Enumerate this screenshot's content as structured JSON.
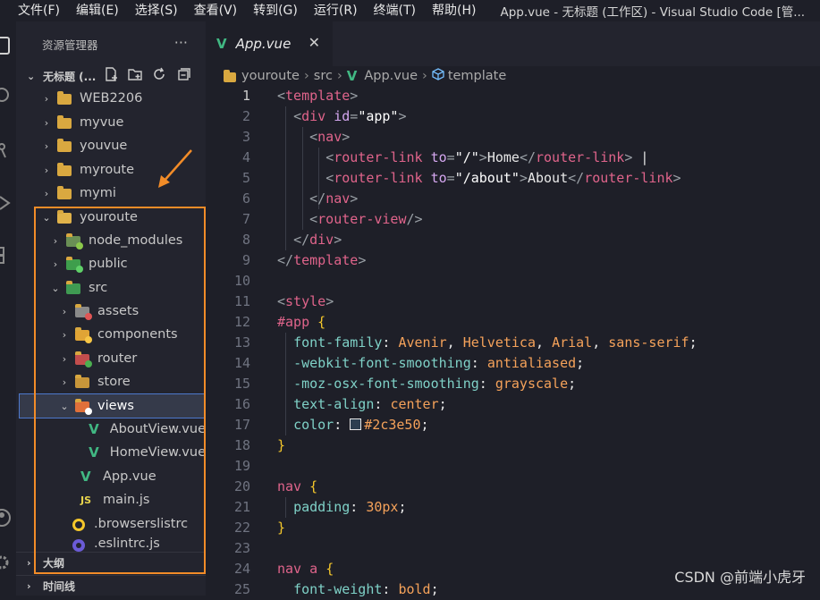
{
  "menubar": {
    "items": [
      "文件(F)",
      "编辑(E)",
      "选择(S)",
      "查看(V)",
      "转到(G)",
      "运行(R)",
      "终端(T)",
      "帮助(H)"
    ],
    "window_title": "App.vue - 无标题 (工作区) - Visual Studio Code [管..."
  },
  "sidebar": {
    "header": "资源管理器",
    "more": "···",
    "workspace": "无标题 (...",
    "tree": [
      {
        "label": "WEB2206",
        "chev": "›",
        "icon": "folder"
      },
      {
        "label": "myvue",
        "chev": "›",
        "icon": "folder"
      },
      {
        "label": "youvue",
        "chev": "›",
        "icon": "folder"
      },
      {
        "label": "myroute",
        "chev": "›",
        "icon": "folder"
      },
      {
        "label": "mymi",
        "chev": "›",
        "icon": "folder"
      },
      {
        "label": "youroute",
        "chev": "⌄",
        "icon": "folder-open"
      },
      {
        "label": "node_modules",
        "chev": "›",
        "icon": "folder-node"
      },
      {
        "label": "public",
        "chev": "›",
        "icon": "folder-public"
      },
      {
        "label": "src",
        "chev": "⌄",
        "icon": "folder-src"
      },
      {
        "label": "assets",
        "chev": "›",
        "icon": "folder-assets"
      },
      {
        "label": "components",
        "chev": "›",
        "icon": "folder-components"
      },
      {
        "label": "router",
        "chev": "›",
        "icon": "folder-router"
      },
      {
        "label": "store",
        "chev": "›",
        "icon": "folder-store"
      },
      {
        "label": "views",
        "chev": "⌄",
        "icon": "folder-views"
      },
      {
        "label": "AboutView.vue",
        "chev": "",
        "icon": "vue-file"
      },
      {
        "label": "HomeView.vue",
        "chev": "",
        "icon": "vue-file"
      },
      {
        "label": "App.vue",
        "chev": "",
        "icon": "vue-file"
      },
      {
        "label": "main.js",
        "chev": "",
        "icon": "js-file"
      },
      {
        "label": ".browserslistrc",
        "chev": "",
        "icon": "browserslist-file"
      },
      {
        "label": ".eslintrc.js",
        "chev": "",
        "icon": "eslint-file"
      }
    ],
    "panels": [
      "大纲",
      "时间线"
    ]
  },
  "editor": {
    "tab": {
      "label": "App.vue",
      "close": "✕"
    },
    "breadcrumbs": [
      "youroute",
      "src",
      "App.vue",
      "template"
    ],
    "line_numbers": [
      "1",
      "2",
      "3",
      "4",
      "5",
      "6",
      "7",
      "8",
      "9",
      "10",
      "11",
      "12",
      "13",
      "14",
      "15",
      "16",
      "17",
      "18",
      "19",
      "20",
      "21",
      "22",
      "23",
      "24",
      "25"
    ]
  },
  "watermark": "CSDN @前端小虎牙",
  "colors": {
    "highlight": "#f28c28",
    "vue": "#41b883",
    "folder": "#d9a840"
  }
}
